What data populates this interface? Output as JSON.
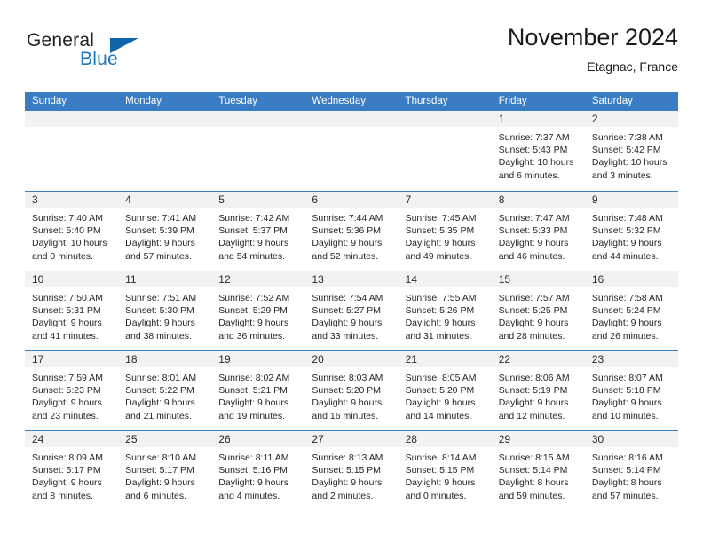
{
  "brand": {
    "name_top": "General",
    "name_bottom": "Blue",
    "accent_color": "#1065a8",
    "blue_text_color": "#1f77c2"
  },
  "header": {
    "title": "November 2024",
    "subtitle": "Etagnac, France"
  },
  "theme": {
    "header_row_bg": "#3b7dc4",
    "daynum_band_bg": "#f2f2f2",
    "cell_bg": "#ffffff",
    "text_color": "#262626"
  },
  "weekdays": [
    "Sunday",
    "Monday",
    "Tuesday",
    "Wednesday",
    "Thursday",
    "Friday",
    "Saturday"
  ],
  "weeks": [
    [
      {
        "day": "",
        "lines": []
      },
      {
        "day": "",
        "lines": []
      },
      {
        "day": "",
        "lines": []
      },
      {
        "day": "",
        "lines": []
      },
      {
        "day": "",
        "lines": []
      },
      {
        "day": "1",
        "lines": [
          "Sunrise: 7:37 AM",
          "Sunset: 5:43 PM",
          "Daylight: 10 hours",
          "and 6 minutes."
        ]
      },
      {
        "day": "2",
        "lines": [
          "Sunrise: 7:38 AM",
          "Sunset: 5:42 PM",
          "Daylight: 10 hours",
          "and 3 minutes."
        ]
      }
    ],
    [
      {
        "day": "3",
        "lines": [
          "Sunrise: 7:40 AM",
          "Sunset: 5:40 PM",
          "Daylight: 10 hours",
          "and 0 minutes."
        ]
      },
      {
        "day": "4",
        "lines": [
          "Sunrise: 7:41 AM",
          "Sunset: 5:39 PM",
          "Daylight: 9 hours",
          "and 57 minutes."
        ]
      },
      {
        "day": "5",
        "lines": [
          "Sunrise: 7:42 AM",
          "Sunset: 5:37 PM",
          "Daylight: 9 hours",
          "and 54 minutes."
        ]
      },
      {
        "day": "6",
        "lines": [
          "Sunrise: 7:44 AM",
          "Sunset: 5:36 PM",
          "Daylight: 9 hours",
          "and 52 minutes."
        ]
      },
      {
        "day": "7",
        "lines": [
          "Sunrise: 7:45 AM",
          "Sunset: 5:35 PM",
          "Daylight: 9 hours",
          "and 49 minutes."
        ]
      },
      {
        "day": "8",
        "lines": [
          "Sunrise: 7:47 AM",
          "Sunset: 5:33 PM",
          "Daylight: 9 hours",
          "and 46 minutes."
        ]
      },
      {
        "day": "9",
        "lines": [
          "Sunrise: 7:48 AM",
          "Sunset: 5:32 PM",
          "Daylight: 9 hours",
          "and 44 minutes."
        ]
      }
    ],
    [
      {
        "day": "10",
        "lines": [
          "Sunrise: 7:50 AM",
          "Sunset: 5:31 PM",
          "Daylight: 9 hours",
          "and 41 minutes."
        ]
      },
      {
        "day": "11",
        "lines": [
          "Sunrise: 7:51 AM",
          "Sunset: 5:30 PM",
          "Daylight: 9 hours",
          "and 38 minutes."
        ]
      },
      {
        "day": "12",
        "lines": [
          "Sunrise: 7:52 AM",
          "Sunset: 5:29 PM",
          "Daylight: 9 hours",
          "and 36 minutes."
        ]
      },
      {
        "day": "13",
        "lines": [
          "Sunrise: 7:54 AM",
          "Sunset: 5:27 PM",
          "Daylight: 9 hours",
          "and 33 minutes."
        ]
      },
      {
        "day": "14",
        "lines": [
          "Sunrise: 7:55 AM",
          "Sunset: 5:26 PM",
          "Daylight: 9 hours",
          "and 31 minutes."
        ]
      },
      {
        "day": "15",
        "lines": [
          "Sunrise: 7:57 AM",
          "Sunset: 5:25 PM",
          "Daylight: 9 hours",
          "and 28 minutes."
        ]
      },
      {
        "day": "16",
        "lines": [
          "Sunrise: 7:58 AM",
          "Sunset: 5:24 PM",
          "Daylight: 9 hours",
          "and 26 minutes."
        ]
      }
    ],
    [
      {
        "day": "17",
        "lines": [
          "Sunrise: 7:59 AM",
          "Sunset: 5:23 PM",
          "Daylight: 9 hours",
          "and 23 minutes."
        ]
      },
      {
        "day": "18",
        "lines": [
          "Sunrise: 8:01 AM",
          "Sunset: 5:22 PM",
          "Daylight: 9 hours",
          "and 21 minutes."
        ]
      },
      {
        "day": "19",
        "lines": [
          "Sunrise: 8:02 AM",
          "Sunset: 5:21 PM",
          "Daylight: 9 hours",
          "and 19 minutes."
        ]
      },
      {
        "day": "20",
        "lines": [
          "Sunrise: 8:03 AM",
          "Sunset: 5:20 PM",
          "Daylight: 9 hours",
          "and 16 minutes."
        ]
      },
      {
        "day": "21",
        "lines": [
          "Sunrise: 8:05 AM",
          "Sunset: 5:20 PM",
          "Daylight: 9 hours",
          "and 14 minutes."
        ]
      },
      {
        "day": "22",
        "lines": [
          "Sunrise: 8:06 AM",
          "Sunset: 5:19 PM",
          "Daylight: 9 hours",
          "and 12 minutes."
        ]
      },
      {
        "day": "23",
        "lines": [
          "Sunrise: 8:07 AM",
          "Sunset: 5:18 PM",
          "Daylight: 9 hours",
          "and 10 minutes."
        ]
      }
    ],
    [
      {
        "day": "24",
        "lines": [
          "Sunrise: 8:09 AM",
          "Sunset: 5:17 PM",
          "Daylight: 9 hours",
          "and 8 minutes."
        ]
      },
      {
        "day": "25",
        "lines": [
          "Sunrise: 8:10 AM",
          "Sunset: 5:17 PM",
          "Daylight: 9 hours",
          "and 6 minutes."
        ]
      },
      {
        "day": "26",
        "lines": [
          "Sunrise: 8:11 AM",
          "Sunset: 5:16 PM",
          "Daylight: 9 hours",
          "and 4 minutes."
        ]
      },
      {
        "day": "27",
        "lines": [
          "Sunrise: 8:13 AM",
          "Sunset: 5:15 PM",
          "Daylight: 9 hours",
          "and 2 minutes."
        ]
      },
      {
        "day": "28",
        "lines": [
          "Sunrise: 8:14 AM",
          "Sunset: 5:15 PM",
          "Daylight: 9 hours",
          "and 0 minutes."
        ]
      },
      {
        "day": "29",
        "lines": [
          "Sunrise: 8:15 AM",
          "Sunset: 5:14 PM",
          "Daylight: 8 hours",
          "and 59 minutes."
        ]
      },
      {
        "day": "30",
        "lines": [
          "Sunrise: 8:16 AM",
          "Sunset: 5:14 PM",
          "Daylight: 8 hours",
          "and 57 minutes."
        ]
      }
    ]
  ]
}
